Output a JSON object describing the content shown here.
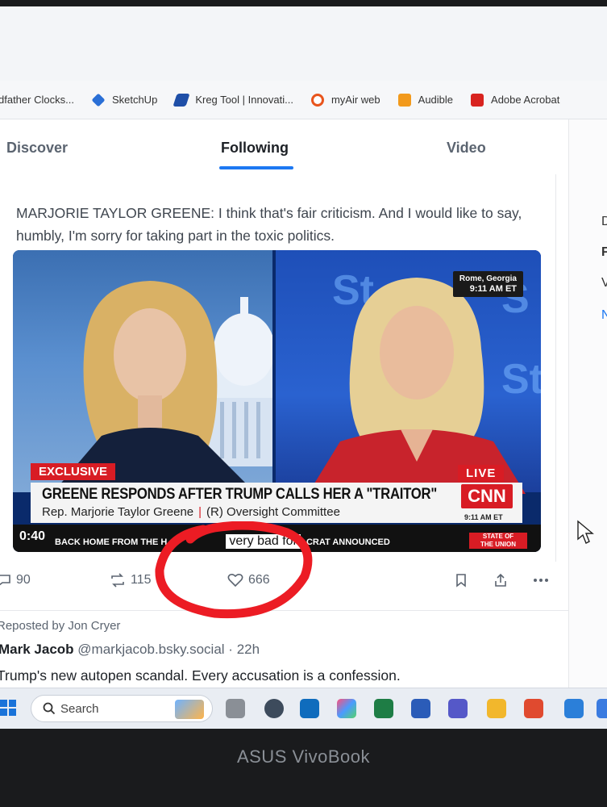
{
  "bookmarks": [
    {
      "label": "dfather Clocks...",
      "icon": "page-icon",
      "color": "#7a7a7a"
    },
    {
      "label": "SketchUp",
      "icon": "sketchup-icon",
      "color": "#2a6fd6"
    },
    {
      "label": "Kreg Tool | Innovati...",
      "icon": "kreg-icon",
      "color": "#1f4fa8"
    },
    {
      "label": "myAir web",
      "icon": "myair-icon",
      "color": "#e8541c"
    },
    {
      "label": "Audible",
      "icon": "audible-icon",
      "color": "#f29a1c"
    },
    {
      "label": "Adobe Acrobat",
      "icon": "acrobat-icon",
      "color": "#d8231f"
    }
  ],
  "tabs": {
    "discover": "Discover",
    "following": "Following",
    "video": "Video"
  },
  "accent_color": "#1d78f2",
  "post": {
    "text": "MARJORIE TAYLOR GREENE: I think that's fair criticism. And I would like to say, humbly, I'm sorry for taking part in the toxic politics.",
    "video": {
      "exclusive": "EXCLUSIVE",
      "live": "LIVE",
      "location": "Rome, Georgia",
      "location_time": "9:11 AM ET",
      "headline": "GREENE RESPONDS AFTER TRUMP CALLS HER A \"TRAITOR\"",
      "subline_name": "Rep. Marjorie Taylor Greene",
      "subline_sep": "|",
      "subline_role": "(R) Oversight Committee",
      "network": "CNN",
      "network_time": "9:11 AM ET",
      "duration": "0:40",
      "ticker": "BACK HOME FROM THE H",
      "ticker_caption": "very bad for",
      "ticker_tail": "CRAT ANNOUNCED",
      "show_badge_line1": "STATE OF",
      "show_badge_line2": "THE UNION"
    },
    "actions": {
      "replies": "90",
      "reposts": "115",
      "likes": "666"
    }
  },
  "next_post": {
    "repost_line": "Reposted by Jon Cryer",
    "author_name": "Mark Jacob",
    "author_handle": "@markjacob.bsky.social",
    "time_sep": "·",
    "time": "22h",
    "text": "Trump's new autopen scandal. Every accusation is a confession."
  },
  "taskbar": {
    "search_label": "Search"
  },
  "bezel": {
    "brand": "ASUS VivoBook"
  },
  "annotation_color": "#ec1c24"
}
